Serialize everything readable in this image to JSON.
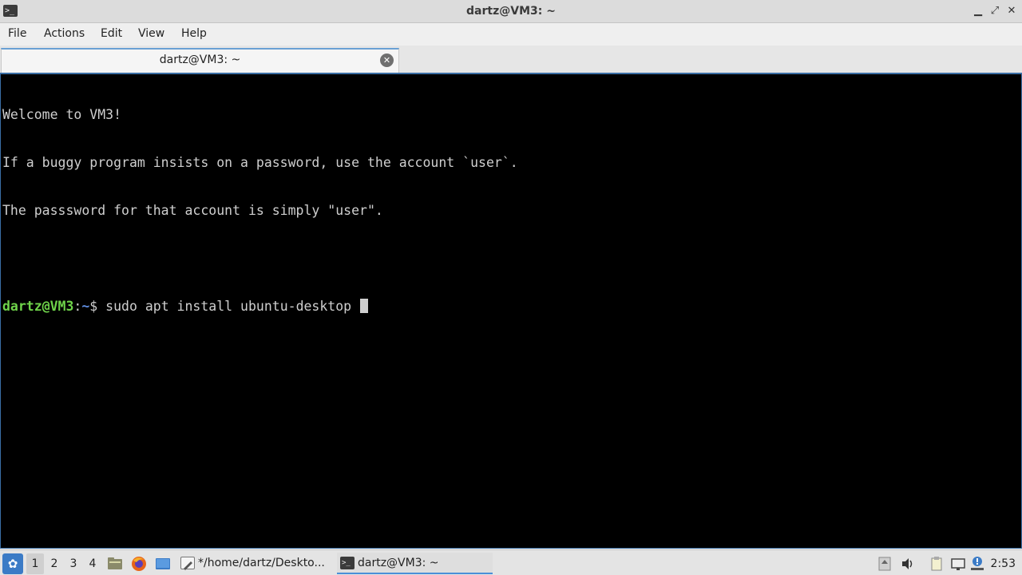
{
  "window": {
    "title": "dartz@VM3: ~",
    "app_icon_glyph": ">_",
    "minimize_glyph": "▁",
    "maximize_glyph": "⤢",
    "close_glyph": "✕"
  },
  "menu": [
    "File",
    "Actions",
    "Edit",
    "View",
    "Help"
  ],
  "tabs": [
    {
      "label": "dartz@VM3: ~",
      "close_glyph": "✕"
    }
  ],
  "terminal": {
    "lines": [
      "Welcome to VM3!",
      "If a buggy program insists on a password, use the account `user`.",
      "The passsword for that account is simply \"user\".",
      ""
    ],
    "prompt": {
      "user_host": "dartz@VM3",
      "sep": ":",
      "path": "~",
      "symbol": "$ ",
      "command": "sudo apt install ubuntu-desktop "
    },
    "colors": {
      "background": "#000000",
      "text": "#cfcfcf",
      "user": "#6fd34a",
      "path": "#5f8de0"
    }
  },
  "taskbar": {
    "start_glyph": "✿",
    "desktops": [
      "1",
      "2",
      "3",
      "4"
    ],
    "active_desktop": "1",
    "launchers": [
      "file-manager-icon",
      "firefox-icon",
      "show-desktop-icon"
    ],
    "tasks": [
      {
        "label": "*/home/dartz/Deskto...",
        "icon": "text-editor-icon",
        "active": false
      },
      {
        "label": "dartz@VM3: ~",
        "icon": "terminal-icon",
        "active": true
      }
    ],
    "tray": [
      "updates-icon",
      "volume-icon",
      "clipboard-icon",
      "network-icon",
      "notification-icon"
    ],
    "clock": "2:53"
  }
}
